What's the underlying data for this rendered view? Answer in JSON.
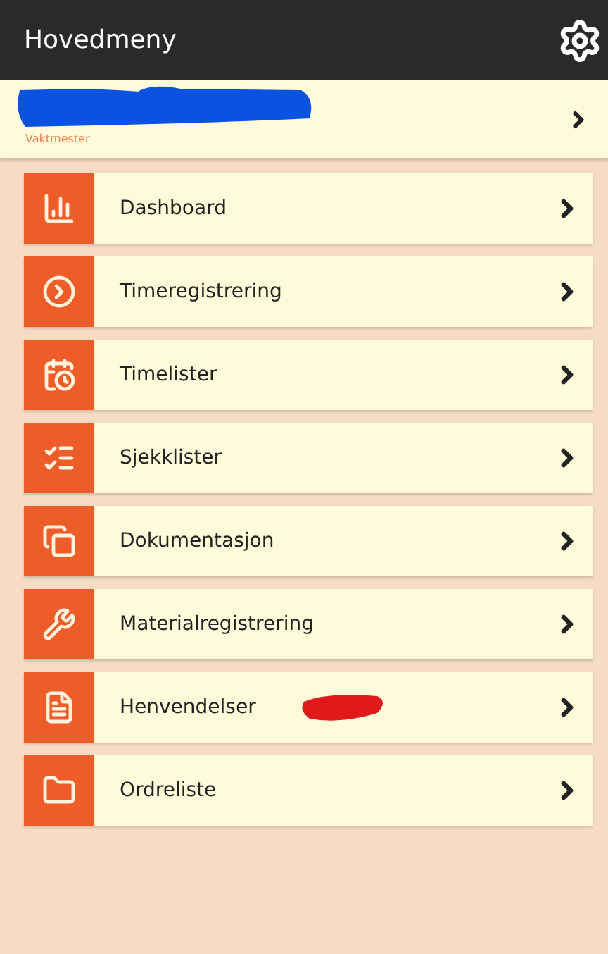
{
  "header": {
    "title": "Hovedmeny"
  },
  "user": {
    "role": "Vaktmester",
    "redacted": true
  },
  "menu": [
    {
      "label": "Dashboard",
      "kind": "chart",
      "marked": false
    },
    {
      "label": "Timeregistrering",
      "kind": "play",
      "marked": false
    },
    {
      "label": "Timelister",
      "kind": "calendar",
      "marked": false
    },
    {
      "label": "Sjekklister",
      "kind": "checklist",
      "marked": false
    },
    {
      "label": "Dokumentasjon",
      "kind": "copies",
      "marked": false
    },
    {
      "label": "Materialregistrering",
      "kind": "wrench",
      "marked": false
    },
    {
      "label": "Henvendelser",
      "kind": "document",
      "marked": true
    },
    {
      "label": "Ordreliste",
      "kind": "folder",
      "marked": false
    }
  ]
}
